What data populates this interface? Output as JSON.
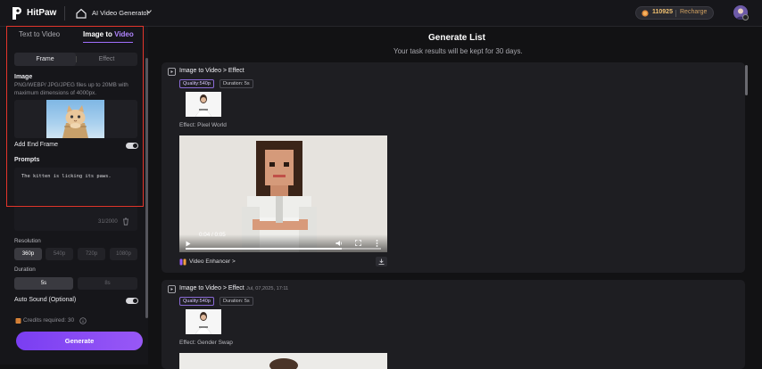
{
  "header": {
    "brand": "HitPaw",
    "app_name": "AI Video Generator",
    "credits": "110925",
    "recharge": "Recharge"
  },
  "sidebar": {
    "tabs": [
      "Text to Video",
      "Image to ",
      "Video"
    ],
    "frame_tabs": [
      "Frame",
      "Effect"
    ],
    "image_label": "Image",
    "image_hint": "PNG/WEBP/ JPG/JPEG files up to 20MB with maximum dimensions of 4000px.",
    "end_frame_label": "Add End Frame",
    "prompts_label": "Prompts",
    "prompt_text": "The kitten is licking its paws.",
    "char_count": "31/2000",
    "resolution_label": "Resolution",
    "resolutions": [
      "360p",
      "540p",
      "720p",
      "1080p"
    ],
    "duration_label": "Duration",
    "durations": [
      "5s",
      "8s"
    ],
    "auto_sound_label": "Auto Sound (Optional)",
    "credits_required": "Credits required: 30",
    "generate": "Generate"
  },
  "main": {
    "title": "Generate List",
    "subtitle": "Your task results will be kept for 30 days.",
    "cards": [
      {
        "title": "Image to Video > Effect",
        "date": "",
        "quality": "Quality:540p",
        "duration": "Duration: 5s",
        "effect": "Effect: Pixel World",
        "video_time": "0:04 / 0:05",
        "enhancer": "Video Enhancer >"
      },
      {
        "title": "Image to Video > Effect",
        "date": "Jul, 07,2025, 17:11",
        "quality": "Quality:540p",
        "duration": "Duration: 5s",
        "effect": "Effect: Gender Swap"
      }
    ]
  },
  "colors": {
    "accent": "#8b4cf5",
    "highlight": "#e3352b",
    "credit": "#f0c070"
  }
}
